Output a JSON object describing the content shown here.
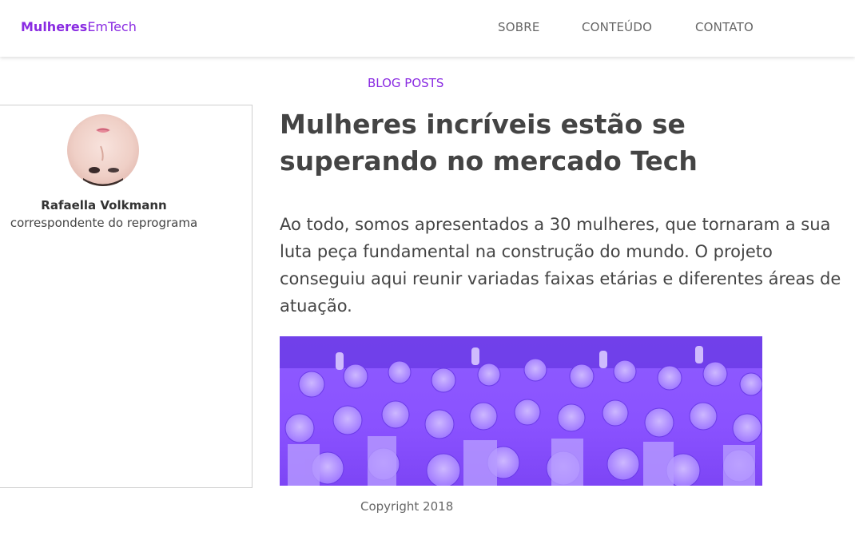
{
  "header": {
    "logo_bold": "Mulheres",
    "logo_regular": "EmTech",
    "nav": [
      "SOBRE",
      "CONTEÚDO",
      "CONTATO"
    ]
  },
  "section_label": "BLOG POSTS",
  "author": {
    "name": "Rafaella Volkmann",
    "role": "correspondente do reprograma"
  },
  "post": {
    "title": "Mulheres incríveis estão se superando no mercado Tech",
    "body": "Ao todo, somos apresentados a 30 mulheres, que tornaram a sua luta peça fundamental na construção do mundo. O projeto conseguiu aqui reunir variadas faixas etárias e diferentes áreas de atuação."
  },
  "footer": {
    "copyright": "Copyright 2018"
  },
  "colors": {
    "brand": "#8a2be2",
    "text": "#444444",
    "photo_tint": "#8a52ff"
  }
}
